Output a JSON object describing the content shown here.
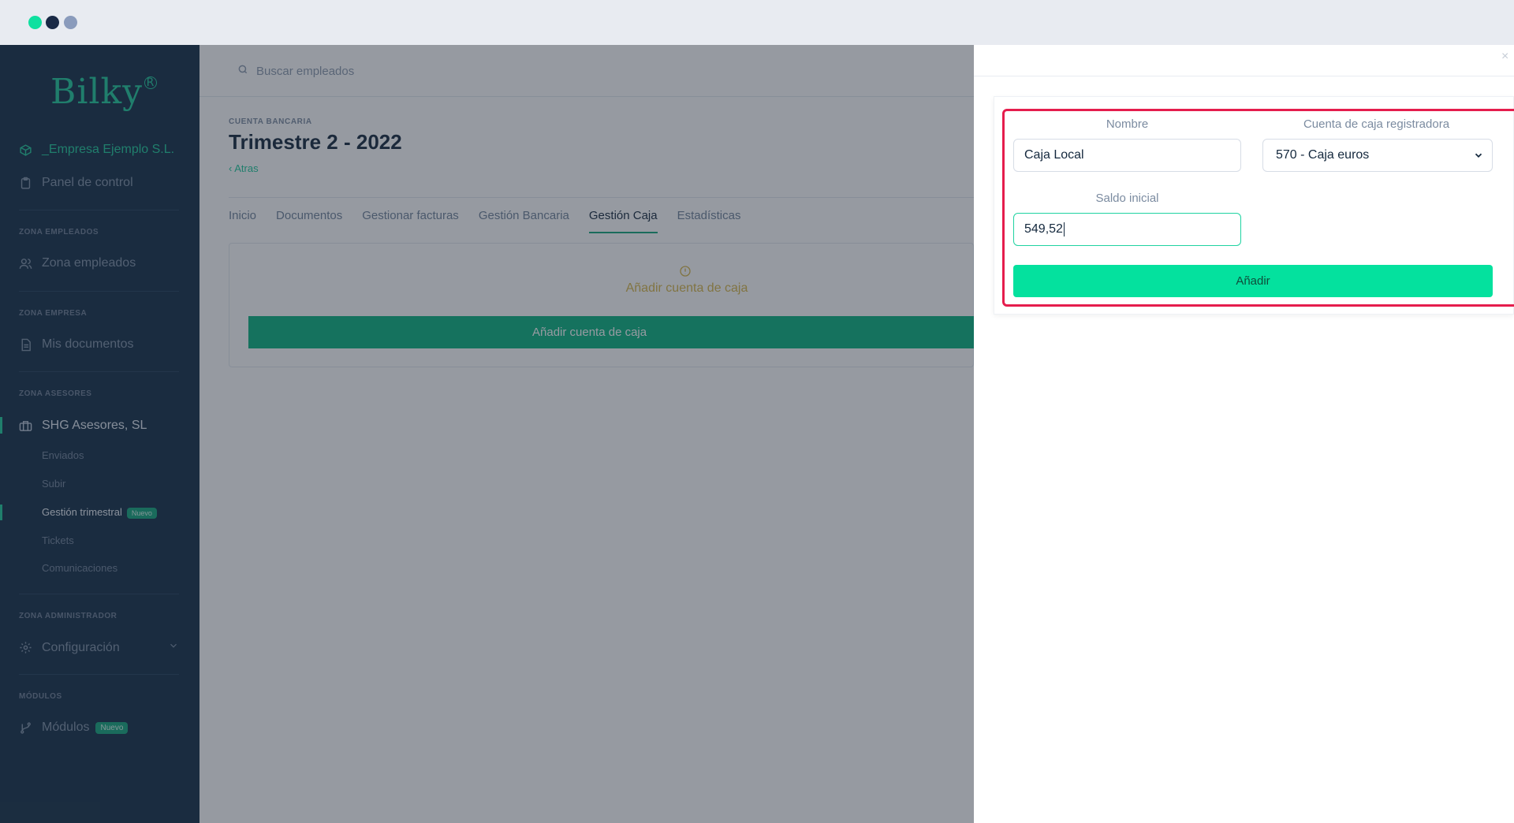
{
  "brand": {
    "name": "Bilky",
    "mark": "R"
  },
  "sidebar": {
    "company": "_Empresa Ejemplo S.L.",
    "panel": "Panel de control",
    "sections": {
      "empleados": "ZONA EMPLEADOS",
      "empresa": "ZONA EMPRESA",
      "asesores": "ZONA ASESORES",
      "administrador": "ZONA ADMINISTRADOR",
      "modulos": "MÓDULOS"
    },
    "zona_empleados": "Zona empleados",
    "mis_documentos": "Mis documentos",
    "asesores_name": "SHG Asesores, SL",
    "sub_items": [
      "Enviados",
      "Subir",
      "Gestión trimestral",
      "Tickets",
      "Comunicaciones"
    ],
    "nuevo_badge": "Nuevo",
    "configuracion": "Configuración",
    "modulos": "Módulos"
  },
  "header": {
    "search_placeholder": "Buscar empleados"
  },
  "page": {
    "eyebrow": "CUENTA BANCARIA",
    "title": "Trimestre 2 - 2022",
    "back": "Atras",
    "tabs": [
      "Inicio",
      "Documentos",
      "Gestionar facturas",
      "Gestión Bancaria",
      "Gestión Caja",
      "Estadísticas"
    ],
    "active_tab": "Gestión Caja",
    "warning_text": "Añadir cuenta de caja",
    "add_button": "Añadir cuenta de caja"
  },
  "drawer": {
    "close": "×",
    "nombre_label": "Nombre",
    "nombre_value": "Caja Local",
    "cuenta_label": "Cuenta de caja registradora",
    "cuenta_value": "570 - Caja euros",
    "saldo_label": "Saldo inicial",
    "saldo_value": "549,52",
    "submit": "Añadir"
  },
  "colors": {
    "sidebar_bg": "#132d46",
    "accent": "#1ec99a",
    "submit_bg": "#04e19e",
    "highlight": "#e51d4d",
    "warning": "#d7b74a"
  }
}
